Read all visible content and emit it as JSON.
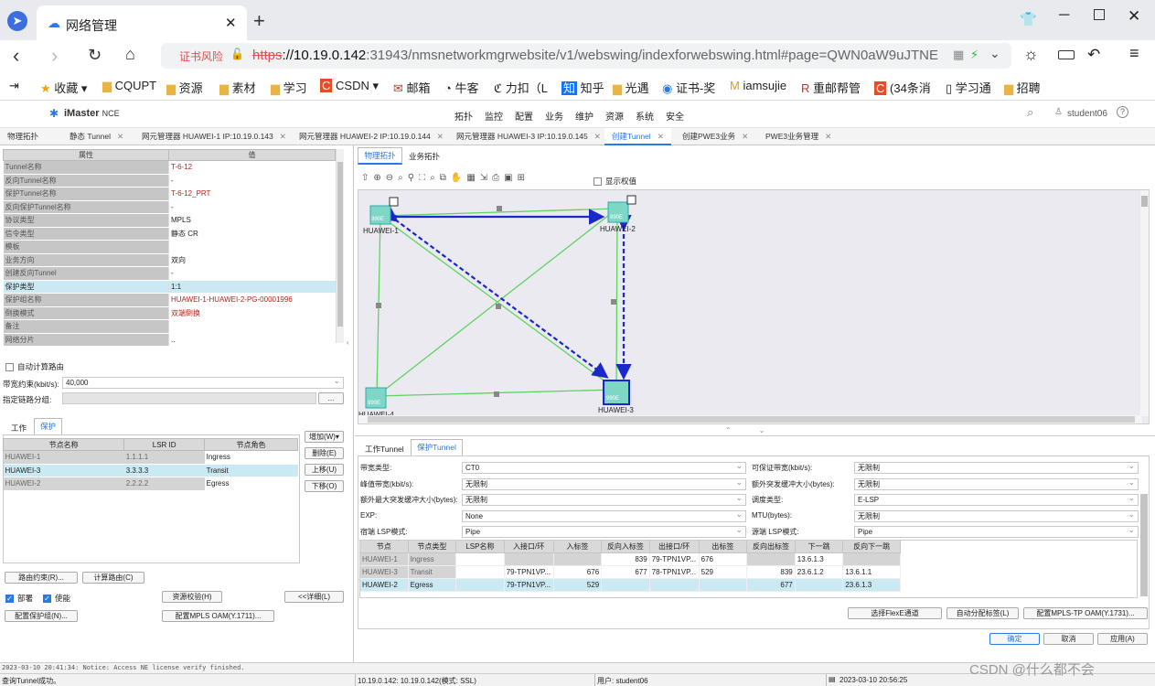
{
  "browser": {
    "tab_title": "网络管理",
    "security_warning": "证书风险",
    "url_https": "https",
    "url_host": "://10.19.0.142",
    "url_rest": ":31943/nmsnetworkmgrwebsite/v1/webswing/indexforwebswing.html#page=QWN0aW9uJTNE",
    "bookmarks": [
      "收藏",
      "CQUPT",
      "资源",
      "素材",
      "学习",
      "CSDN",
      "邮箱",
      "牛客",
      "力扣（L",
      "知乎",
      "光遇",
      "证书-奖",
      "iamsujie",
      "重邮帮管",
      "(34条消",
      "学习通",
      "招聘"
    ]
  },
  "app": {
    "brand": "iMaster",
    "brand_suffix": "NCE",
    "menu": [
      "拓扑",
      "监控",
      "配置",
      "业务",
      "维护",
      "资源",
      "系统",
      "安全"
    ],
    "user": "student06",
    "tabs": [
      "物理拓扑",
      "静态 Tunnel",
      "网元管理器 HUAWEI-1 IP:10.19.0.143",
      "网元管理器 HUAWEI-2 IP:10.19.0.144",
      "网元管理器 HUAWEI-3 IP:10.19.0.145",
      "创建Tunnel",
      "创建PWE3业务",
      "PWE3业务管理"
    ]
  },
  "props": {
    "header_key": "属性",
    "header_val": "值",
    "rows": [
      {
        "k": "Tunnel名称",
        "v": "T-6-12",
        "red": true
      },
      {
        "k": "反向Tunnel名称",
        "v": "-",
        "red": false
      },
      {
        "k": "保护Tunnel名称",
        "v": "T-6-12_PRT",
        "red": true
      },
      {
        "k": "反向保护Tunnel名称",
        "v": "-",
        "red": false
      },
      {
        "k": "协议类型",
        "v": "MPLS",
        "red": false
      },
      {
        "k": "信令类型",
        "v": "静态 CR",
        "red": false
      },
      {
        "k": "模板",
        "v": "",
        "red": false
      },
      {
        "k": "业务方向",
        "v": "双向",
        "red": false
      },
      {
        "k": "创建反向Tunnel",
        "v": "-",
        "red": false
      },
      {
        "k": "保护类型",
        "v": "1:1",
        "red": false
      },
      {
        "k": "保护组名称",
        "v": "HUAWEI-1-HUAWEI-2-PG-00001996",
        "red": true
      },
      {
        "k": "倒换模式",
        "v": "双端倒换",
        "red": true
      },
      {
        "k": "备注",
        "v": "",
        "red": false
      },
      {
        "k": "网络分片",
        "v": "..",
        "red": false
      }
    ]
  },
  "left": {
    "auto_route": "自动计算路由",
    "bandwidth_label": "带宽约束(kbit/s):",
    "bandwidth_value": "40,000",
    "link_group_label": "指定链路分组:",
    "browse": "...",
    "tab_work": "工作",
    "tab_protect": "保护",
    "lsr_headers": [
      "节点名称",
      "LSR ID",
      "节点角色"
    ],
    "lsr_rows": [
      [
        "HUAWEI-1",
        "1.1.1.1",
        "Ingress"
      ],
      [
        "HUAWEI-3",
        "3.3.3.3",
        "Transit"
      ],
      [
        "HUAWEI-2",
        "2.2.2.2",
        "Egress"
      ]
    ],
    "btn_add": "增加(W)▾",
    "btn_delete": "删除(E)",
    "btn_up": "上移(U)",
    "btn_down": "下移(O)",
    "btn_route_constraint": "路由约束(R)...",
    "btn_calc_route": "计算路由(C)",
    "chk_deploy": "部署",
    "chk_enable": "使能",
    "btn_resource_check": "资源校验(H)",
    "btn_detail": "<<详细(L)",
    "btn_config_pg": "配置保护组(N)...",
    "btn_oam": "配置MPLS OAM(Y.1711)..."
  },
  "topology": {
    "tab_physical": "物理拓扑",
    "tab_service": "业务拓扑",
    "show_weight": "显示权值",
    "nodes": [
      "HUAWEI-1",
      "HUAWEI-2",
      "HUAWEI-3",
      "HUAWEI-4"
    ],
    "device_label": "990E"
  },
  "bottom": {
    "tab_work_tunnel": "工作Tunnel",
    "tab_protect_tunnel": "保护Tunnel",
    "fields_left": [
      {
        "label": "带宽类型:",
        "value": "CT0"
      },
      {
        "label": "峰值带宽(kbit/s):",
        "value": "无限制"
      },
      {
        "label": "额外最大突发缓冲大小(bytes):",
        "value": "无限制"
      },
      {
        "label": "EXP:",
        "value": "None"
      },
      {
        "label": "宿端 LSP模式:",
        "value": "Pipe"
      }
    ],
    "fields_right": [
      {
        "label": "可保证带宽(kbit/s):",
        "value": "无限制"
      },
      {
        "label": "额外突发缓冲大小(bytes):",
        "value": "无限制"
      },
      {
        "label": "调度类型:",
        "value": "E-LSP"
      },
      {
        "label": "MTU(bytes):",
        "value": "无限制"
      },
      {
        "label": "源端 LSP模式:",
        "value": "Pipe"
      }
    ],
    "table_headers": [
      "节点",
      "节点类型",
      "LSP名称",
      "入接口/环",
      "入标签",
      "反向入标签",
      "出接口/环",
      "出标签",
      "反向出标签",
      "下一跳",
      "反向下一跳"
    ],
    "table_rows": [
      [
        "HUAWEI-1",
        "Ingress",
        "",
        "",
        "",
        "839",
        "79-TPN1VP...",
        "676",
        "",
        "13.6.1.3",
        ""
      ],
      [
        "HUAWEI-3",
        "Transit",
        "",
        "79-TPN1VP...",
        "676",
        "677",
        "78-TPN1VP...",
        "529",
        "839",
        "23.6.1.2",
        "13.6.1.1"
      ],
      [
        "HUAWEI-2",
        "Egress",
        "",
        "79-TPN1VP...",
        "529",
        "",
        "",
        "",
        "677",
        "",
        "23.6.1.3"
      ]
    ],
    "btn_flexe": "选择FlexE通道",
    "btn_auto_label": "自动分配标签(L)",
    "btn_tp_oam": "配置MPLS-TP OAM(Y.1731)...",
    "btn_ok": "确定",
    "btn_cancel": "取消",
    "btn_apply": "应用(A)"
  },
  "status": {
    "log": "2023-03-10 20:41:34: Notice: Access NE license verify finished.",
    "message": "查询Tunnel成功。",
    "server": "10.19.0.142:  10.19.0.142(模式: SSL)",
    "user": "用户: student06",
    "time": "2023-03-10 20:56:25",
    "watermark": "CSDN @什么都不会"
  },
  "colors": {
    "accent": "#2a79e4",
    "protect_path": "#1a27c9",
    "link": "#5fd35f",
    "selected_row": "#cbe9f2",
    "label_red": "#b3251b"
  }
}
